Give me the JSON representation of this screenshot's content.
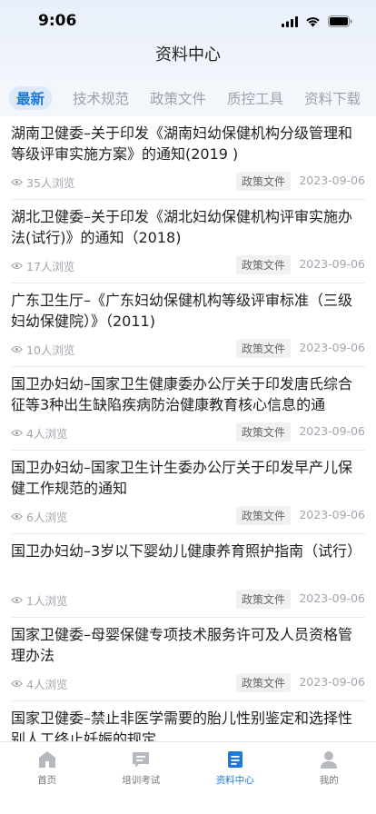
{
  "status": {
    "time": "9:06"
  },
  "nav": {
    "title": "资料中心"
  },
  "tabs": [
    {
      "label": "最新",
      "active": true
    },
    {
      "label": "技术规范",
      "active": false
    },
    {
      "label": "政策文件",
      "active": false
    },
    {
      "label": "质控工具",
      "active": false
    },
    {
      "label": "资料下载",
      "active": false
    }
  ],
  "items": [
    {
      "title": "湖南卫健委–关于印发《湖南妇幼保健机构分级管理和等级评审实施方案》的通知(2019 )",
      "views": "35人浏览",
      "tag": "政策文件",
      "date": "2023-09-06"
    },
    {
      "title": "湖北卫健委–关于印发《湖北妇幼保健机构评审实施办法(试行)》的通知（2018)",
      "views": "17人浏览",
      "tag": "政策文件",
      "date": "2023-09-06"
    },
    {
      "title": "广东卫生厅–《广东妇幼保健机构等级评审标准（三级妇幼保健院）》（2011)",
      "views": "10人浏览",
      "tag": "政策文件",
      "date": "2023-09-06"
    },
    {
      "title": "国卫办妇幼–国家卫生健康委办公厅关于印发唐氏综合征等3种出生缺陷疾病防治健康教育核心信息的通",
      "views": "4人浏览",
      "tag": "政策文件",
      "date": "2023-09-06"
    },
    {
      "title": "国卫办妇幼–国家卫生计生委办公厅关于印发早产儿保健工作规范的通知",
      "views": "6人浏览",
      "tag": "政策文件",
      "date": "2023-09-06"
    },
    {
      "title": "国卫办妇幼–3岁以下婴幼儿健康养育照护指南（试行）",
      "views": "1人浏览",
      "tag": "政策文件",
      "date": "2023-09-06"
    },
    {
      "title": "国家卫健委–母婴保健专项技术服务许可及人员资格管理办法",
      "views": "4人浏览",
      "tag": "政策文件",
      "date": "2023-09-06"
    },
    {
      "title": "国家卫健委–禁止非医学需要的胎儿性别鉴定和选择性别人工终止妊娠的规定",
      "views": "",
      "tag": "",
      "date": ""
    }
  ],
  "tabbar": [
    {
      "label": "首页",
      "icon": "home-icon",
      "active": false
    },
    {
      "label": "培训考试",
      "icon": "training-exam-icon",
      "active": false
    },
    {
      "label": "资料中心",
      "icon": "document-center-icon",
      "active": true
    },
    {
      "label": "我的",
      "icon": "profile-icon",
      "active": false
    }
  ],
  "colors": {
    "accent": "#1b78e0",
    "inactive_tab": "#9aa3ad",
    "meta": "#a0a6ad"
  }
}
